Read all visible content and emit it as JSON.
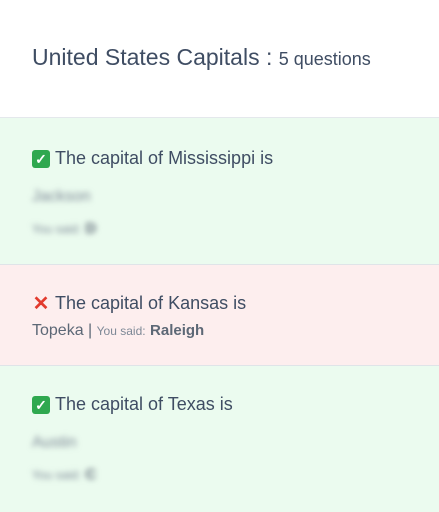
{
  "header": {
    "title": "United States Capitals :",
    "count": "5 questions"
  },
  "questions": [
    {
      "status": "correct",
      "icon": "check-mark-icon",
      "question": "The capital of Mississippi is",
      "answer": "Jackson",
      "you_said_label": "You said:",
      "you_said": "D"
    },
    {
      "status": "wrong",
      "icon": "cross-mark-icon",
      "question": "The capital of Kansas is",
      "answer": "Topeka",
      "separator": "|",
      "you_said_label": "You said:",
      "you_said": "Raleigh"
    },
    {
      "status": "correct",
      "icon": "check-mark-icon",
      "question": "The capital of Texas is",
      "answer": "Austin",
      "you_said_label": "You said:",
      "you_said": "C"
    }
  ],
  "colors": {
    "correct_bg": "#ebfbef",
    "wrong_bg": "#fdeeee",
    "check_green": "#2fa84f",
    "cross_red": "#e23b2e",
    "text": "#3f4d63"
  }
}
